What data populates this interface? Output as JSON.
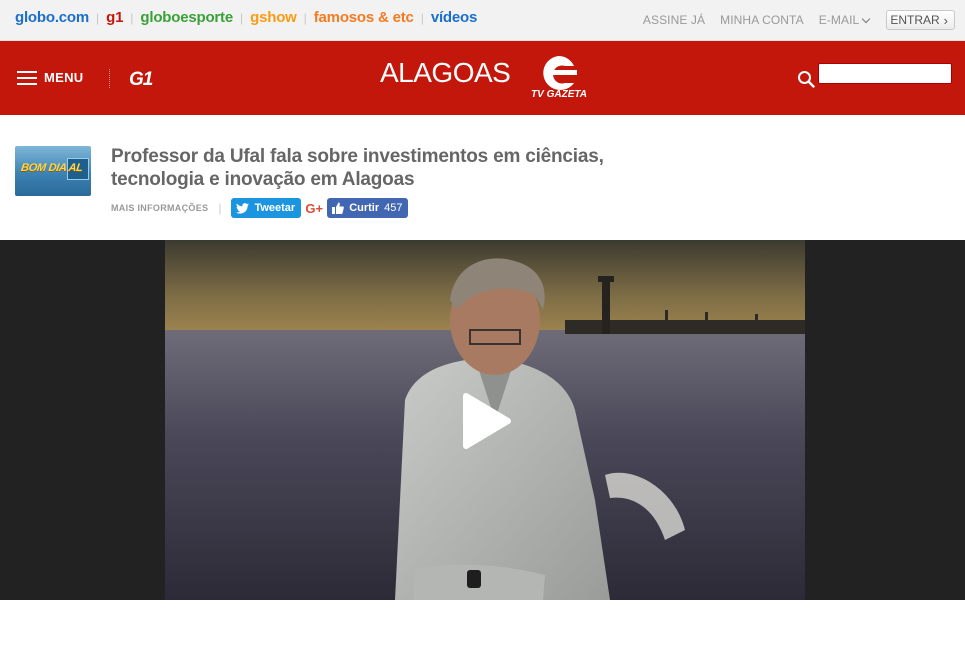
{
  "globobar": {
    "links": [
      {
        "label": "globo.com",
        "color": "#1a6fcc"
      },
      {
        "label": "g1",
        "color": "#c4170c"
      },
      {
        "label": "globoesporte",
        "color": "#3aa137"
      },
      {
        "label": "gshow",
        "color": "#f99c14"
      },
      {
        "label": "famosos & etc",
        "color": "#f47b20"
      },
      {
        "label": "vídeos",
        "color": "#1a6fcc"
      }
    ],
    "assine": "ASSINE JÁ",
    "minha_conta": "MINHA CONTA",
    "email": "E-MAIL",
    "entrar": "ENTRAR"
  },
  "header": {
    "menu_label": "MENU",
    "g1_logo": "G1",
    "region": "ALAGOAS",
    "tv_logo_text": "TV GAZETA",
    "search_value": "",
    "accent_color": "#c4170c"
  },
  "article": {
    "program_thumb_label": "BOM DIA AL",
    "title": "Professor da Ufal fala sobre investimentos em ciências, tecnologia e inovação em Alagoas",
    "mais_informacoes": "MAIS INFORMAÇÕES",
    "tweet_label": "Tweetar",
    "gplus_label": "G+",
    "like_label": "Curtir",
    "like_count": "457"
  },
  "video": {
    "play_icon": "play-icon"
  }
}
